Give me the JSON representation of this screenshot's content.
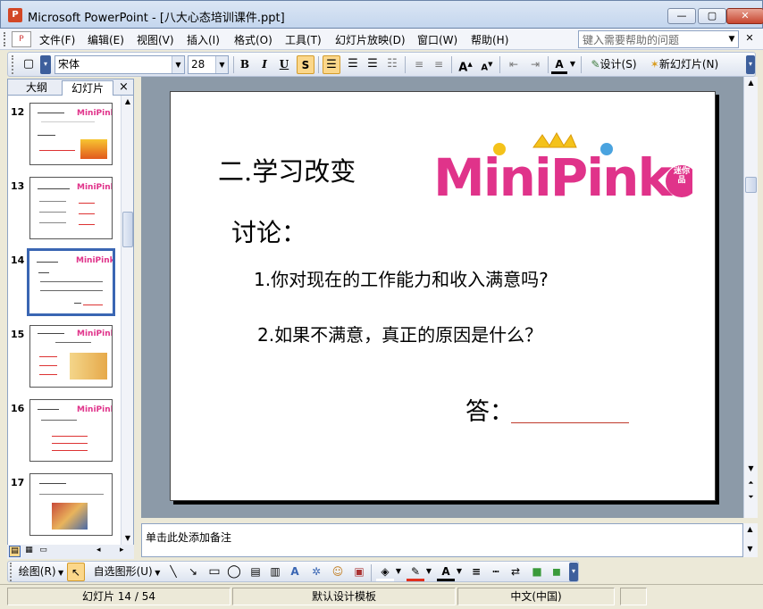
{
  "window": {
    "app_title": "Microsoft PowerPoint - [八大心态培训课件.ppt]",
    "controls": {
      "minimize": "—",
      "maximize": "▢",
      "close": "✕"
    }
  },
  "menu": {
    "items": [
      "文件(F)",
      "编辑(E)",
      "视图(V)",
      "插入(I)",
      "格式(O)",
      "工具(T)",
      "幻灯片放映(D)",
      "窗口(W)",
      "帮助(H)"
    ],
    "help_placeholder": "键入需要帮助的问题"
  },
  "toolbar": {
    "font_name": "宋体",
    "font_size": "28",
    "bold": "B",
    "italic": "I",
    "underline": "U",
    "shadow": "S",
    "font_color_glyph": "A",
    "design_label": "设计(S)",
    "new_slide_label": "新幻灯片(N)"
  },
  "thumbpane": {
    "tab_outline": "大纲",
    "tab_slides": "幻灯片",
    "close": "×",
    "slides": [
      {
        "num": "12"
      },
      {
        "num": "13"
      },
      {
        "num": "14",
        "selected": true
      },
      {
        "num": "15"
      },
      {
        "num": "16"
      },
      {
        "num": "17"
      }
    ]
  },
  "slide": {
    "title": "二.学习改变",
    "logo_text": "MiniPink",
    "logo_badge": "迷你品",
    "discussion": "讨论：",
    "q1": "1.你对现在的工作能力和收入满意吗?",
    "q2": "2.如果不满意，真正的原因是什么？",
    "answer": "答："
  },
  "notes": {
    "placeholder": "单击此处添加备注"
  },
  "drawbar": {
    "draw_label": "绘图(R)",
    "autoshape_label": "自选图形(U)"
  },
  "status": {
    "slide_pos": "幻灯片 14 / 54",
    "template": "默认设计模板",
    "language": "中文(中国)"
  },
  "colors": {
    "logo_pink": "#e0338a",
    "logo_yellow": "#f4c21a",
    "logo_blue": "#4aa3df",
    "answer_line": "#c0392b",
    "selection_border": "#3a66b3"
  }
}
